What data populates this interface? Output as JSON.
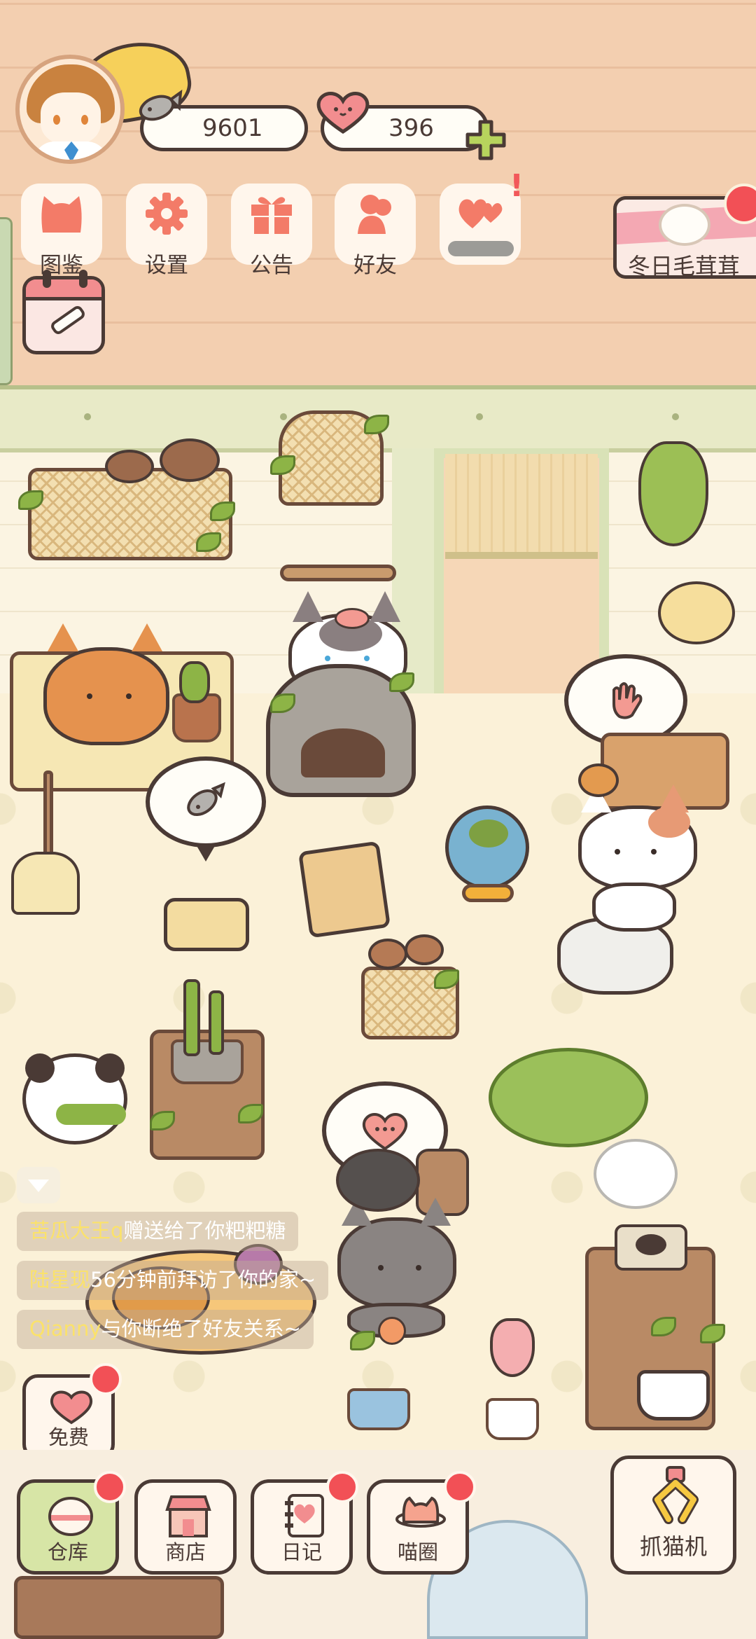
{
  "hud": {
    "fish_currency": "9601",
    "heart_currency": "396"
  },
  "menu": [
    {
      "id": "collection",
      "label": "图鉴",
      "icon": "cat-face-icon",
      "has_badge": false
    },
    {
      "id": "settings",
      "label": "设置",
      "icon": "gear-icon",
      "has_badge": false
    },
    {
      "id": "notice",
      "label": "公告",
      "icon": "gift-icon",
      "has_badge": false
    },
    {
      "id": "friends",
      "label": "好友",
      "icon": "friends-icon",
      "has_badge": false
    },
    {
      "id": "mail",
      "label": "",
      "icon": "hearts-icon",
      "has_badge": true
    }
  ],
  "event": {
    "label": "冬日毛茸茸",
    "icon": "paw-icon"
  },
  "chat": [
    {
      "name": "苦瓜大王q",
      "text": "赠送给了你粑粑糖"
    },
    {
      "name": "陆星现",
      "text": "56分钟前拜访了你的家~"
    },
    {
      "name": "Qianny",
      "text": "与你断绝了好友关系~"
    }
  ],
  "free": {
    "label": "免费"
  },
  "nav": [
    {
      "id": "warehouse",
      "label": "仓库",
      "icon": "warehouse-icon",
      "active": true,
      "has_badge": true
    },
    {
      "id": "shop",
      "label": "商店",
      "icon": "shop-icon",
      "active": false,
      "has_badge": false
    },
    {
      "id": "diary",
      "label": "日记",
      "icon": "diary-icon",
      "active": false,
      "has_badge": true
    },
    {
      "id": "meow-circle",
      "label": "喵圈",
      "icon": "planet-cat-icon",
      "active": false,
      "has_badge": true
    }
  ],
  "claw_machine": {
    "label": "抓猫机"
  },
  "colors": {
    "accent": "#f25056",
    "outline": "#4a3a35",
    "wall": "#f3cfb0",
    "floor": "#fbf1d8",
    "leaf_green": "#8db446"
  }
}
